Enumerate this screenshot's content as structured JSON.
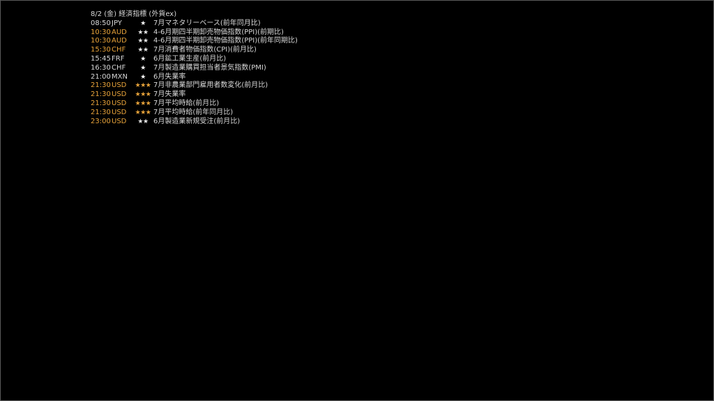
{
  "header": {
    "title": "8/2 (金) 経済指標 (外貨ex)"
  },
  "colors": {
    "background": "#000000",
    "text": "#d8d8d8",
    "highlight": "#e8a33a",
    "border": "#5a5a5a"
  },
  "events": [
    {
      "time": "08:50",
      "currency": "JPY",
      "stars": "★",
      "name": "7月マネタリーベース(前年同月比)",
      "highlight": false
    },
    {
      "time": "10:30",
      "currency": "AUD",
      "stars": "★★",
      "name": "4-6月期四半期卸売物価指数(PPI)(前期比)",
      "highlight": true
    },
    {
      "time": "10:30",
      "currency": "AUD",
      "stars": "★★",
      "name": "4-6月期四半期卸売物価指数(PPI)(前年同期比)",
      "highlight": true
    },
    {
      "time": "15:30",
      "currency": "CHF",
      "stars": "★★",
      "name": "7月消費者物価指数(CPI)(前月比)",
      "highlight": true
    },
    {
      "time": "15:45",
      "currency": "FRF",
      "stars": "★",
      "name": "6月鉱工業生産(前月比)",
      "highlight": false
    },
    {
      "time": "16:30",
      "currency": "CHF",
      "stars": "★",
      "name": "7月製造業購買担当者景気指数(PMI)",
      "highlight": false
    },
    {
      "time": "21:00",
      "currency": "MXN",
      "stars": "★",
      "name": "6月失業率",
      "highlight": false
    },
    {
      "time": "21:30",
      "currency": "USD",
      "stars": "★★★",
      "name": "7月非農業部門雇用者数変化(前月比)",
      "highlight": true
    },
    {
      "time": "21:30",
      "currency": "USD",
      "stars": "★★★",
      "name": "7月失業率",
      "highlight": true
    },
    {
      "time": "21:30",
      "currency": "USD",
      "stars": "★★★",
      "name": "7月平均時給(前月比)",
      "highlight": true
    },
    {
      "time": "21:30",
      "currency": "USD",
      "stars": "★★★",
      "name": "7月平均時給(前年同月比)",
      "highlight": true
    },
    {
      "time": "23:00",
      "currency": "USD",
      "stars": "★★",
      "name": "6月製造業新規受注(前月比)",
      "highlight": true
    }
  ]
}
